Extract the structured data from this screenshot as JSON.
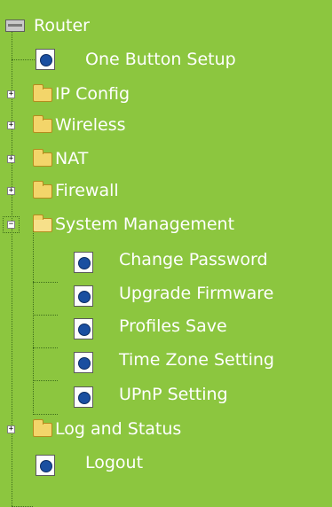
{
  "tree": {
    "root": "Router",
    "one_button_setup": "One Button Setup",
    "ip_config": "IP Config",
    "wireless": "Wireless",
    "nat": "NAT",
    "firewall": "Firewall",
    "system_management": "System Management",
    "system_children": [
      "Change Password",
      "Upgrade Firmware",
      "Profiles Save",
      "Time Zone Setting",
      "UPnP Setting"
    ],
    "log_and_status": "Log and Status",
    "logout": "Logout"
  },
  "icons": {
    "root": "router-icon",
    "folder": "folder-icon",
    "folder_open": "folder-open-icon",
    "page": "page-icon"
  },
  "colors": {
    "background": "#8cc63f",
    "text": "#ffffff"
  }
}
